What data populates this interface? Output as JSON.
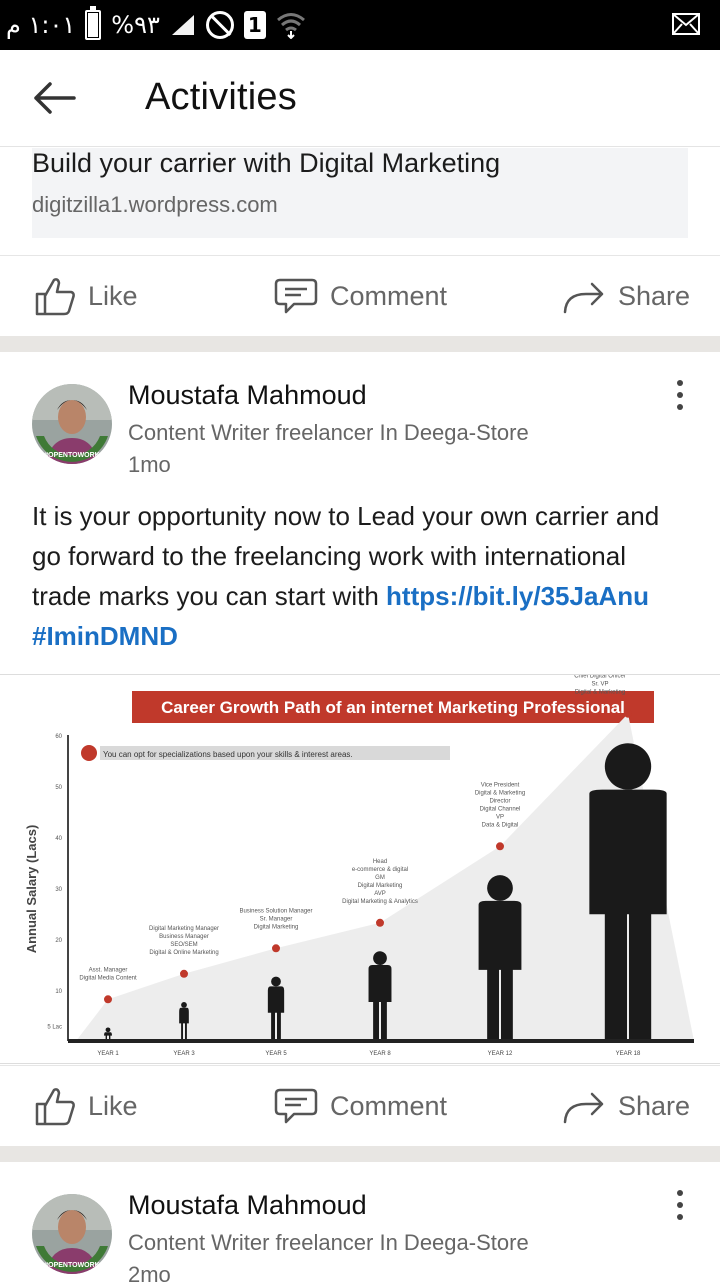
{
  "status_bar": {
    "time": "١:٠١ م",
    "battery": "%٩٣",
    "battery_level": 0.93,
    "sim_badge": "1",
    "icons": [
      "battery-icon",
      "signal-icon",
      "no-disturb-icon",
      "sim-icon",
      "wifi-icon",
      "mail-icon"
    ]
  },
  "header": {
    "title": "Activities",
    "back_icon": "arrow-left-icon"
  },
  "link_preview": {
    "title": "Build your carrier with Digital Marketing",
    "domain": "digitzilla1.wordpress.com"
  },
  "actions": {
    "like": "Like",
    "comment": "Comment",
    "share": "Share"
  },
  "posts": [
    {
      "author": "Moustafa Mahmoud",
      "subtitle": "Content Writer freelancer In Deega-Store",
      "time": "1mo",
      "avatar_badge": "#OPENTOWORK",
      "text": "It is your opportunity now to Lead your own carrier and go forward to the freelancing work with international trade marks you can start with ",
      "link": "https://bit.ly/35JaAnu #IminDMND"
    },
    {
      "author": "Moustafa Mahmoud",
      "subtitle": "Content Writer freelancer In Deega-Store",
      "time": "2mo",
      "avatar_badge": "#OPENTOWORK"
    }
  ],
  "chart_data": {
    "type": "area",
    "title": "Career Growth Path of an internet Marketing Professional",
    "note": "You can opt for specializations based upon your skills & interest areas.",
    "ylabel": "Annual Salary (Lacs)",
    "yticks": [
      "5 Lac",
      "10",
      "20",
      "30",
      "40",
      "50",
      "60"
    ],
    "ylim": [
      0,
      60
    ],
    "categories": [
      "YEAR 1",
      "YEAR 3",
      "YEAR 5",
      "YEAR 8",
      "YEAR 12",
      "YEAR 18"
    ],
    "values": [
      7,
      12,
      17,
      22,
      37,
      63
    ],
    "roles": [
      "Asst. Manager - Digital Media Content",
      "Digital Marketing Manager - Business Manager - SEO/SEM - Digital & Online Marketing",
      "Business Solution Manager - Sr. Manager - Digital Marketing",
      "Head - e-commerce & digital - GM - Digital Marketing - AVP - Digital Marketing & Analytics",
      "Vice President - Digital & Marketing - Director - Digital Channel - VP - Data & Digital",
      "Chief Digital Officer - Sr. VP - Digital & Marketing"
    ],
    "colors": {
      "title_bg": "#c0392b",
      "marker": "#c0392b",
      "figure": "#1a1a1a"
    }
  }
}
